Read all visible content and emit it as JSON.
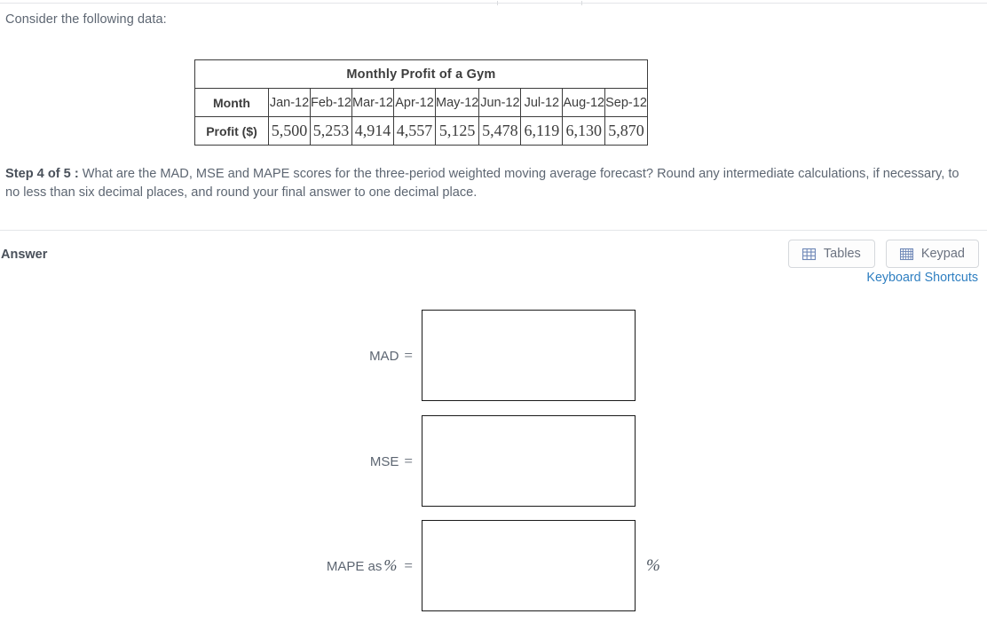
{
  "intro": {
    "text": "Consider the following data:"
  },
  "data_table": {
    "title": "Monthly Profit of a Gym",
    "row_headers": [
      "Month",
      "Profit ($)"
    ],
    "months": [
      "Jan-12",
      "Feb-12",
      "Mar-12",
      "Apr-12",
      "May-12",
      "Jun-12",
      "Jul-12",
      "Aug-12",
      "Sep-12"
    ],
    "profits": [
      "5,500",
      "5,253",
      "4,914",
      "4,557",
      "5,125",
      "5,478",
      "6,119",
      "6,130",
      "5,870"
    ]
  },
  "question": {
    "step": "Step 4 of 5 :",
    "text": "What are the MAD, MSE and MAPE scores for the three-period weighted moving average forecast? Round any intermediate calculations, if necessary, to no less than six decimal places, and round your final answer to one decimal place."
  },
  "answer": {
    "label": "Answer",
    "tables_button": "Tables",
    "keypad_button": "Keypad",
    "keyboard_shortcuts": "Keyboard Shortcuts",
    "fields": [
      {
        "name": "MAD",
        "label_prefix": "MAD",
        "percent_in_label": "",
        "equals": "=",
        "value": "",
        "placeholder": "",
        "suffix": ""
      },
      {
        "name": "MSE",
        "label_prefix": "MSE",
        "percent_in_label": "",
        "equals": "=",
        "value": "",
        "placeholder": "",
        "suffix": ""
      },
      {
        "name": "MAPE",
        "label_prefix": "MAPE as",
        "percent_in_label": "%",
        "equals": "=",
        "value": "",
        "placeholder": "",
        "suffix": "%"
      }
    ]
  },
  "colors": {
    "link": "#2f7fc1",
    "text": "#5d6672",
    "box_border": "#1a1a1a",
    "table_border": "#3c3c3c"
  }
}
